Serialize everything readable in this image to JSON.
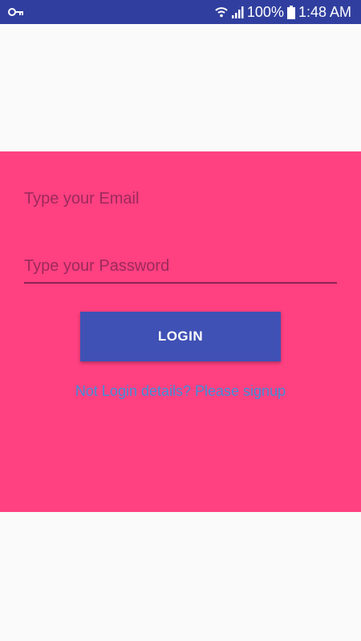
{
  "status_bar": {
    "battery_percent": "100%",
    "time": "1:48 AM",
    "icons": [
      "key-icon",
      "wifi-icon",
      "signal-icon",
      "battery-icon"
    ]
  },
  "form": {
    "email_placeholder": "Type your Email",
    "password_placeholder": "Type your Password",
    "login_label": "LOGIN",
    "signup_link": "Not Login details? Please signup"
  },
  "colors": {
    "status_bar": "#303f9f",
    "panel": "#ff4081",
    "button": "#3f51b5",
    "link": "#3f8fd8",
    "background": "#fafafa"
  }
}
